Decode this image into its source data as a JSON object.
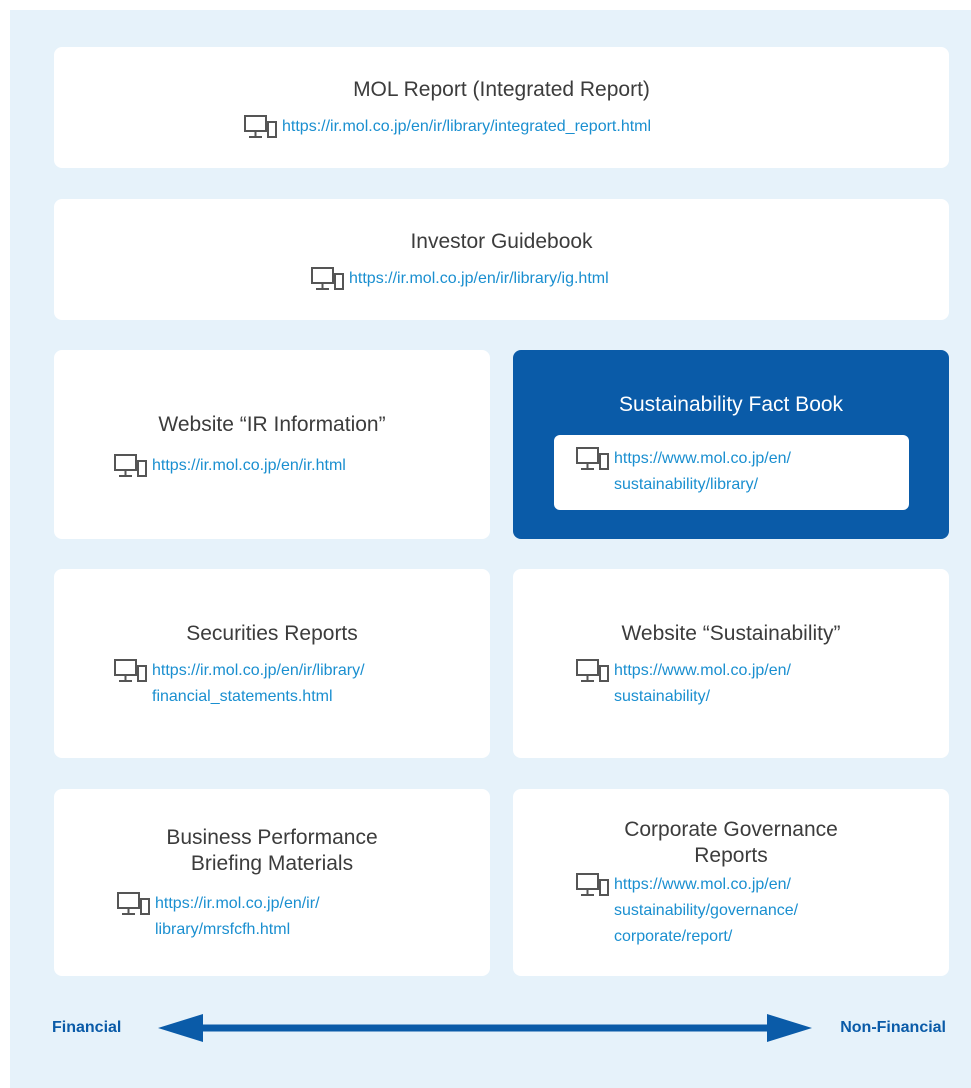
{
  "cards": {
    "mol_report": {
      "title": "MOL Report (Integrated Report)",
      "url": "https://ir.mol.co.jp/en/ir/library/integrated_report.html"
    },
    "investor_guidebook": {
      "title": "Investor Guidebook",
      "url": "https://ir.mol.co.jp/en/ir/library/ig.html"
    },
    "ir_information": {
      "title": "Website “IR Information”",
      "url": "https://ir.mol.co.jp/en/ir.html"
    },
    "fact_book": {
      "title": "Sustainability Fact Book",
      "url": "https://www.mol.co.jp/en/\nsustainability/library/"
    },
    "securities": {
      "title": "Securities Reports",
      "url": "https://ir.mol.co.jp/en/ir/library/\nfinancial_statements.html"
    },
    "sustainability_site": {
      "title": "Website “Sustainability”",
      "url": "https://www.mol.co.jp/en/\nsustainability/"
    },
    "briefing": {
      "title": "Business Performance\nBriefing Materials",
      "url": "https://ir.mol.co.jp/en/ir/\nlibrary/mrsfcfh.html"
    },
    "governance": {
      "title": "Corporate Governance\nReports",
      "url": "https://www.mol.co.jp/en/\nsustainability/governance/\ncorporate/report/"
    }
  },
  "axis": {
    "left_label": "Financial",
    "right_label": "Non-Financial"
  },
  "icons": {
    "link_icon": "monitor-and-phone-icon"
  },
  "colors": {
    "panel_bg": "#e6f2fa",
    "accent_blue": "#0a5ba8",
    "link_blue": "#1a8fd0"
  }
}
